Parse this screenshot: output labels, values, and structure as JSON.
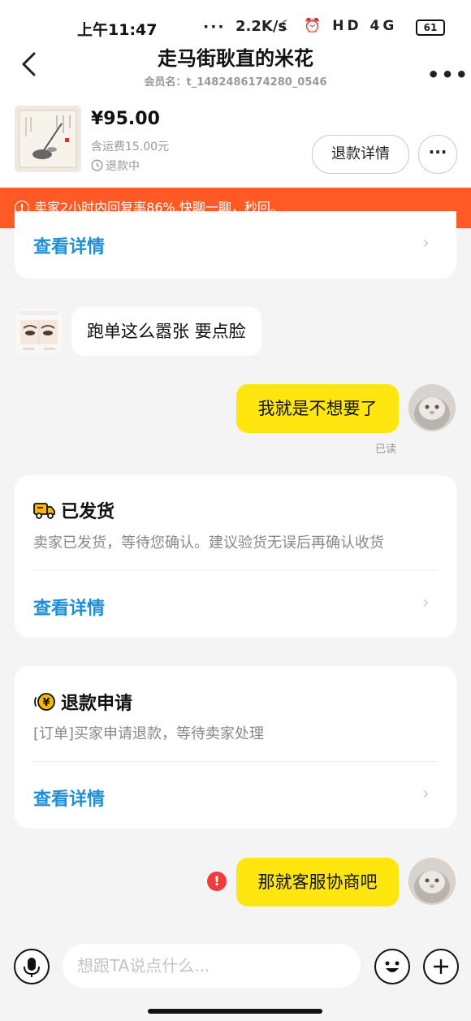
{
  "status": {
    "time": "上午11:47",
    "dots": "···",
    "net_speed": "2.2K/s",
    "icons": "☾ ⏰ HD 4G",
    "battery": "61"
  },
  "header": {
    "title": "走马街耿直的米花",
    "member": "会员名：t_1482486174280_0546"
  },
  "product": {
    "price": "¥95.00",
    "shipping": "含运费15.00元",
    "status": "退款中",
    "refund_detail_label": "退款详情"
  },
  "banner": {
    "text": "卖家2小时内回复率86%,快聊一聊，秒回。"
  },
  "top_card": {
    "link": "查看详情"
  },
  "messages": [
    {
      "side": "left",
      "text": "跑单这么嚣张 要点脸"
    },
    {
      "side": "right",
      "text": "我就是不想要了",
      "read": "已读"
    },
    {
      "side": "right",
      "text": "那就客服协商吧",
      "error": "!"
    }
  ],
  "shipped_card": {
    "title": "已发货",
    "desc": "卖家已发货，等待您确认。建议验货无误后再确认收货",
    "link": "查看详情"
  },
  "refund_card": {
    "title": "退款申请",
    "desc": "[订单]买家申请退款，等待卖家处理",
    "link": "查看详情"
  },
  "input": {
    "placeholder": "想跟TA说点什么..."
  },
  "colors": {
    "banner": "#ff5a25",
    "link": "#1e8fd6",
    "bubble_mine": "#ffe60f",
    "error": "#f23b3b"
  }
}
